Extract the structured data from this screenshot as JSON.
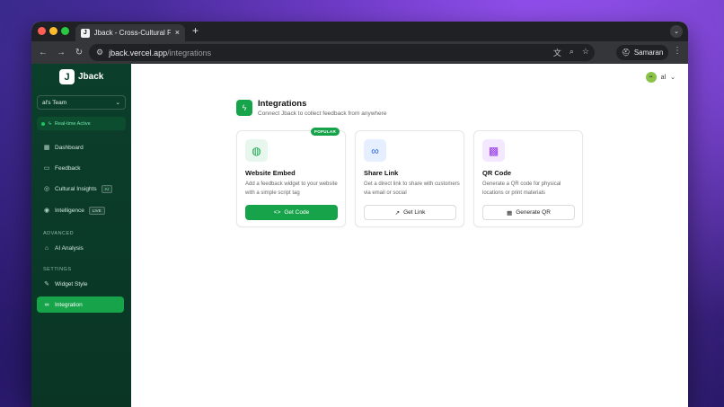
{
  "browser": {
    "tab_title": "Jback - Cross-Cultural Feedb",
    "tab_favicon": "J",
    "tab_close": "×",
    "new_tab": "+",
    "url_host": "jback.vercel.app",
    "url_path": "/integrations",
    "profile_name": "Samaran"
  },
  "sidebar": {
    "brand_logo": "J",
    "brand_name": "Jback",
    "team_name": "al's Team",
    "realtime_label": "Real-time Active",
    "items": [
      {
        "label": "Dashboard",
        "icon": "grid-icon"
      },
      {
        "label": "Feedback",
        "icon": "chat-icon"
      },
      {
        "label": "Cultural Insights",
        "icon": "globe-icon",
        "badge": "AI"
      },
      {
        "label": "Intelligence",
        "icon": "target-icon",
        "badge": "LIVE"
      }
    ],
    "advanced_label": "ADVANCED",
    "advanced_items": [
      {
        "label": "AI Analysis",
        "icon": "robot-icon"
      }
    ],
    "settings_label": "SETTINGS",
    "settings_items": [
      {
        "label": "Widget Style",
        "icon": "palette-icon"
      },
      {
        "label": "Integration",
        "icon": "link-icon",
        "active": true
      }
    ]
  },
  "user": {
    "name": "al",
    "avatar": "••"
  },
  "page": {
    "title": "Integrations",
    "subtitle": "Connect Jback to collect feedback from anywhere"
  },
  "cards": [
    {
      "title": "Website Embed",
      "description": "Add a feedback widget to your website with a simple script tag",
      "button": "Get Code",
      "badge": "POPULAR",
      "icon": "globe-icon"
    },
    {
      "title": "Share Link",
      "description": "Get a direct link to share with customers via email or social",
      "button": "Get Link",
      "icon": "link-icon"
    },
    {
      "title": "QR Code",
      "description": "Generate a QR code for physical locations or print materials",
      "button": "Generate QR",
      "icon": "qr-code-icon"
    }
  ],
  "colors": {
    "sidebar_bg": "#0b3f2b",
    "accent": "#16a34a"
  }
}
